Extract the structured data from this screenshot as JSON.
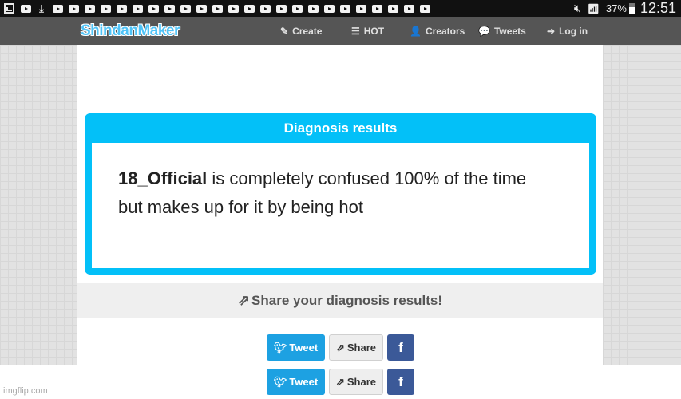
{
  "status_bar": {
    "notification_icons": [
      "gallery-icon",
      "youtube-icon",
      "download-icon",
      "youtube-icon",
      "youtube-icon",
      "youtube-icon",
      "youtube-icon",
      "youtube-icon",
      "youtube-icon",
      "youtube-icon",
      "youtube-icon",
      "youtube-icon",
      "youtube-icon",
      "youtube-icon",
      "youtube-icon",
      "youtube-icon",
      "youtube-icon",
      "youtube-icon",
      "youtube-icon",
      "youtube-icon",
      "youtube-icon",
      "youtube-icon",
      "youtube-icon",
      "youtube-icon",
      "youtube-icon",
      "youtube-icon",
      "youtube-icon"
    ],
    "battery_percent": "37%",
    "time": "12:51"
  },
  "navbar": {
    "logo": "ShindanMaker",
    "items": [
      {
        "label": "Create",
        "icon": "edit-icon",
        "glyph": "✎"
      },
      {
        "label": "HOT",
        "icon": "list-icon",
        "glyph": "☰"
      },
      {
        "label": "Creators",
        "icon": "user-icon",
        "glyph": "👤"
      },
      {
        "label": "Tweets",
        "icon": "comments-icon",
        "glyph": "💬"
      },
      {
        "label": "Log in",
        "icon": "sign-in-icon",
        "glyph": "➜"
      }
    ]
  },
  "result_card": {
    "title": "Diagnosis results",
    "name": "18_Official",
    "line1": " is completely confused 100% of the time",
    "line2": "but makes up for it by being hot"
  },
  "share": {
    "title": "Share your diagnosis results!",
    "icon": "share-icon"
  },
  "buttons": {
    "tweet": "Tweet",
    "share": "Share",
    "facebook": "f"
  },
  "colors": {
    "accent": "#03c0f8",
    "navbar": "#555555",
    "twitter": "#1da1e2",
    "facebook": "#3b5998"
  },
  "watermark": "imgflip.com"
}
